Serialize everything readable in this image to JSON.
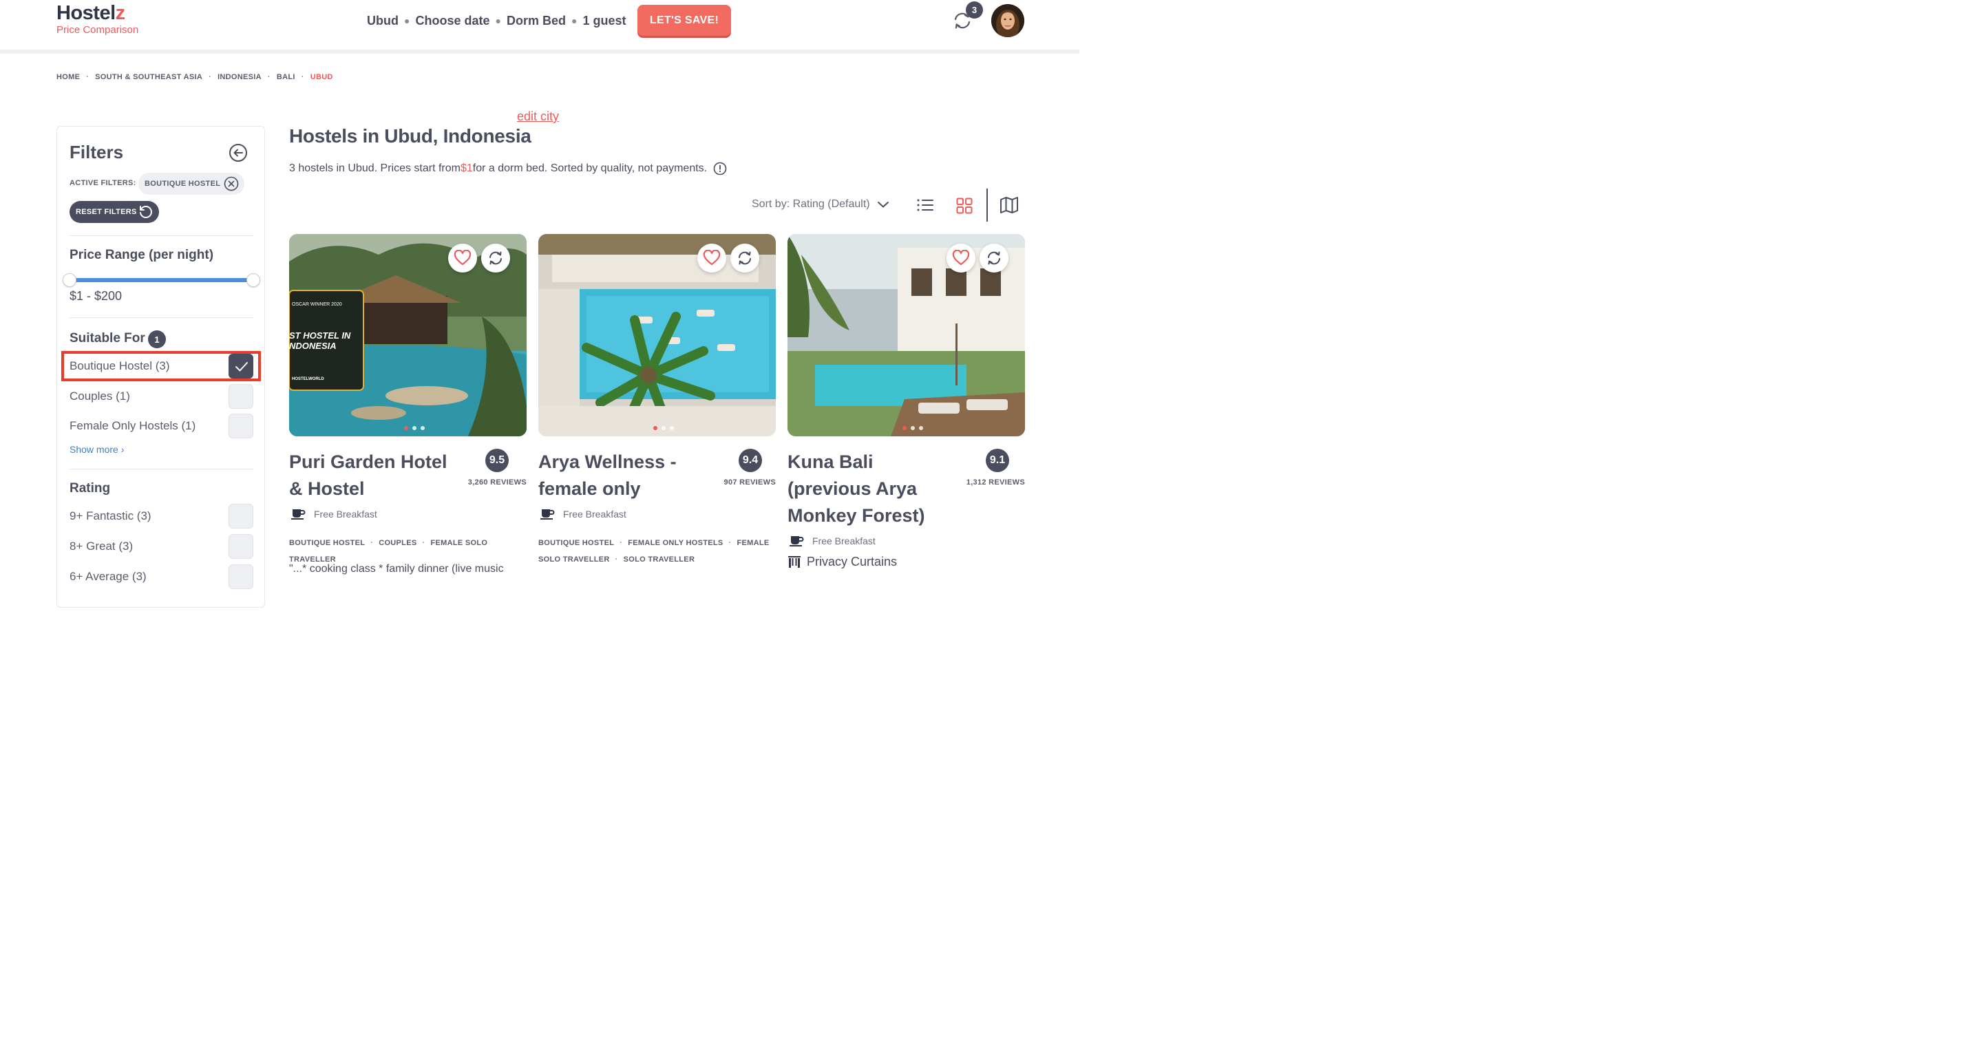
{
  "header": {
    "logo_main": "Hostel",
    "logo_z": "z",
    "logo_sub": "Price Comparison",
    "search": {
      "city": "Ubud",
      "date": "Choose date",
      "room": "Dorm Bed",
      "guests": "1 guest"
    },
    "save_label": "LET'S SAVE!",
    "compare_count": "3"
  },
  "breadcrumb": [
    "HOME",
    "SOUTH & SOUTHEAST ASIA",
    "INDONESIA",
    "BALI",
    "UBUD"
  ],
  "sidebar": {
    "title": "Filters",
    "active_filters_label": "ACTIVE FILTERS:",
    "active_chip": "BOUTIQUE HOSTEL",
    "reset_label": "RESET FILTERS",
    "price_title": "Price Range (per night)",
    "price_value": "$1 - $200",
    "price_range": {
      "min": 1,
      "max": 200,
      "selected_min": 1,
      "selected_max": 200
    },
    "suitable_title": "Suitable For",
    "suitable_count": "1",
    "suitable_options": [
      {
        "label": "Boutique Hostel (3)",
        "checked": true
      },
      {
        "label": "Couples (1)",
        "checked": false
      },
      {
        "label": "Female Only Hostels (1)",
        "checked": false
      }
    ],
    "show_more": "Show more ›",
    "rating_title": "Rating",
    "rating_options": [
      {
        "label": "9+ Fantastic (3)",
        "checked": false
      },
      {
        "label": "8+ Great (3)",
        "checked": false
      },
      {
        "label": "6+ Average (3)",
        "checked": false
      }
    ]
  },
  "main": {
    "edit_city": "edit city",
    "title": "Hostels in Ubud, Indonesia",
    "summary_before": "3 hostels in Ubud. Prices start from ",
    "summary_price": "$1",
    "summary_after": " for a dorm bed. Sorted by quality, not payments.",
    "sort_label": "Sort by: Rating (Default)"
  },
  "cards": [
    {
      "name": "Puri Garden Hotel & Hostel",
      "rating": "9.5",
      "reviews": "3,260 REVIEWS",
      "amenity": "Free Breakfast",
      "tags": [
        "BOUTIQUE HOSTEL",
        "COUPLES",
        "FEMALE SOLO TRAVELLER"
      ],
      "snippet": "\"...* cooking class * family dinner (live music",
      "image_overlay_lines": [
        "OSCAR WINNER 2020",
        "ST HOSTEL IN",
        "NDONESIA",
        "HOSTELWORLD"
      ]
    },
    {
      "name": "Arya Wellness - female only",
      "rating": "9.4",
      "reviews": "907 REVIEWS",
      "amenity": "Free Breakfast",
      "tags": [
        "BOUTIQUE HOSTEL",
        "FEMALE ONLY HOSTELS",
        "FEMALE SOLO TRAVELLER",
        "SOLO TRAVELLER"
      ]
    },
    {
      "name": "Kuna Bali (previous Arya Monkey Forest)",
      "rating": "9.1",
      "reviews": "1,312 REVIEWS",
      "amenity": "Free Breakfast",
      "extra_amenity": "Privacy Curtains"
    }
  ],
  "colors": {
    "accent": "#f05a5a",
    "dark": "#4a4d5e",
    "slider": "#4b8fd9",
    "highlight": "#e83d2c"
  }
}
